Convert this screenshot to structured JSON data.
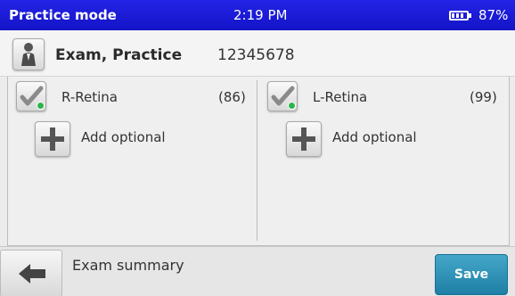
{
  "status_bar": {
    "mode": "Practice mode",
    "time": "2:19 PM",
    "battery_percent": "87%",
    "battery_level": 0.87
  },
  "patient": {
    "name": "Exam, Practice",
    "id": "12345678",
    "icon": "person-icon"
  },
  "eyes": [
    {
      "label": "R-Retina",
      "count": "(86)",
      "status_icon": "checkmark-icon",
      "status_color": "#2db54a",
      "add_label": "Add optional"
    },
    {
      "label": "L-Retina",
      "count": "(99)",
      "status_icon": "checkmark-icon",
      "status_color": "#2db54a",
      "add_label": "Add optional"
    }
  ],
  "bottom_bar": {
    "back_icon": "back-arrow-icon",
    "summary_label": "Exam summary",
    "save_label": "Save"
  },
  "colors": {
    "status_bar": "#1a1ad8",
    "save_button": "#2a8fb5",
    "ok_dot": "#2db54a"
  }
}
